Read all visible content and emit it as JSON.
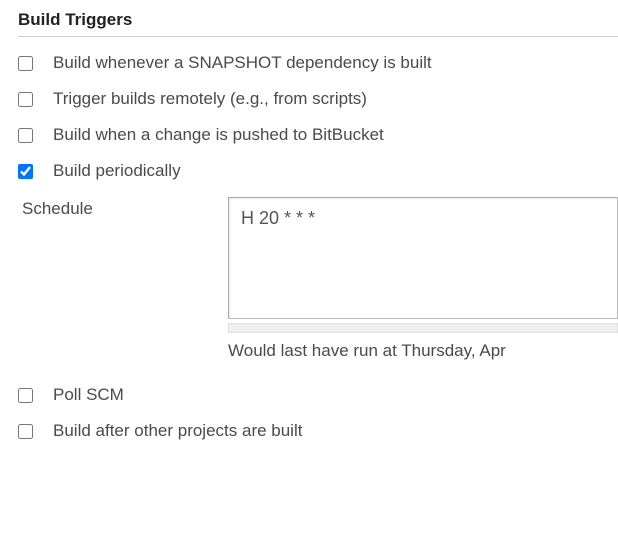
{
  "section": {
    "title": "Build Triggers"
  },
  "triggers": [
    {
      "label": "Build whenever a SNAPSHOT dependency is built",
      "checked": false
    },
    {
      "label": "Trigger builds remotely (e.g., from scripts)",
      "checked": false
    },
    {
      "label": "Build when a change is pushed to BitBucket",
      "checked": false
    },
    {
      "label": "Build periodically",
      "checked": true
    }
  ],
  "schedule": {
    "label": "Schedule",
    "value": "H 20 * * *",
    "hint": "Would last have run at Thursday, Apr"
  },
  "triggers_after": [
    {
      "label": "Poll SCM",
      "checked": false
    },
    {
      "label": "Build after other projects are built",
      "checked": false
    }
  ]
}
